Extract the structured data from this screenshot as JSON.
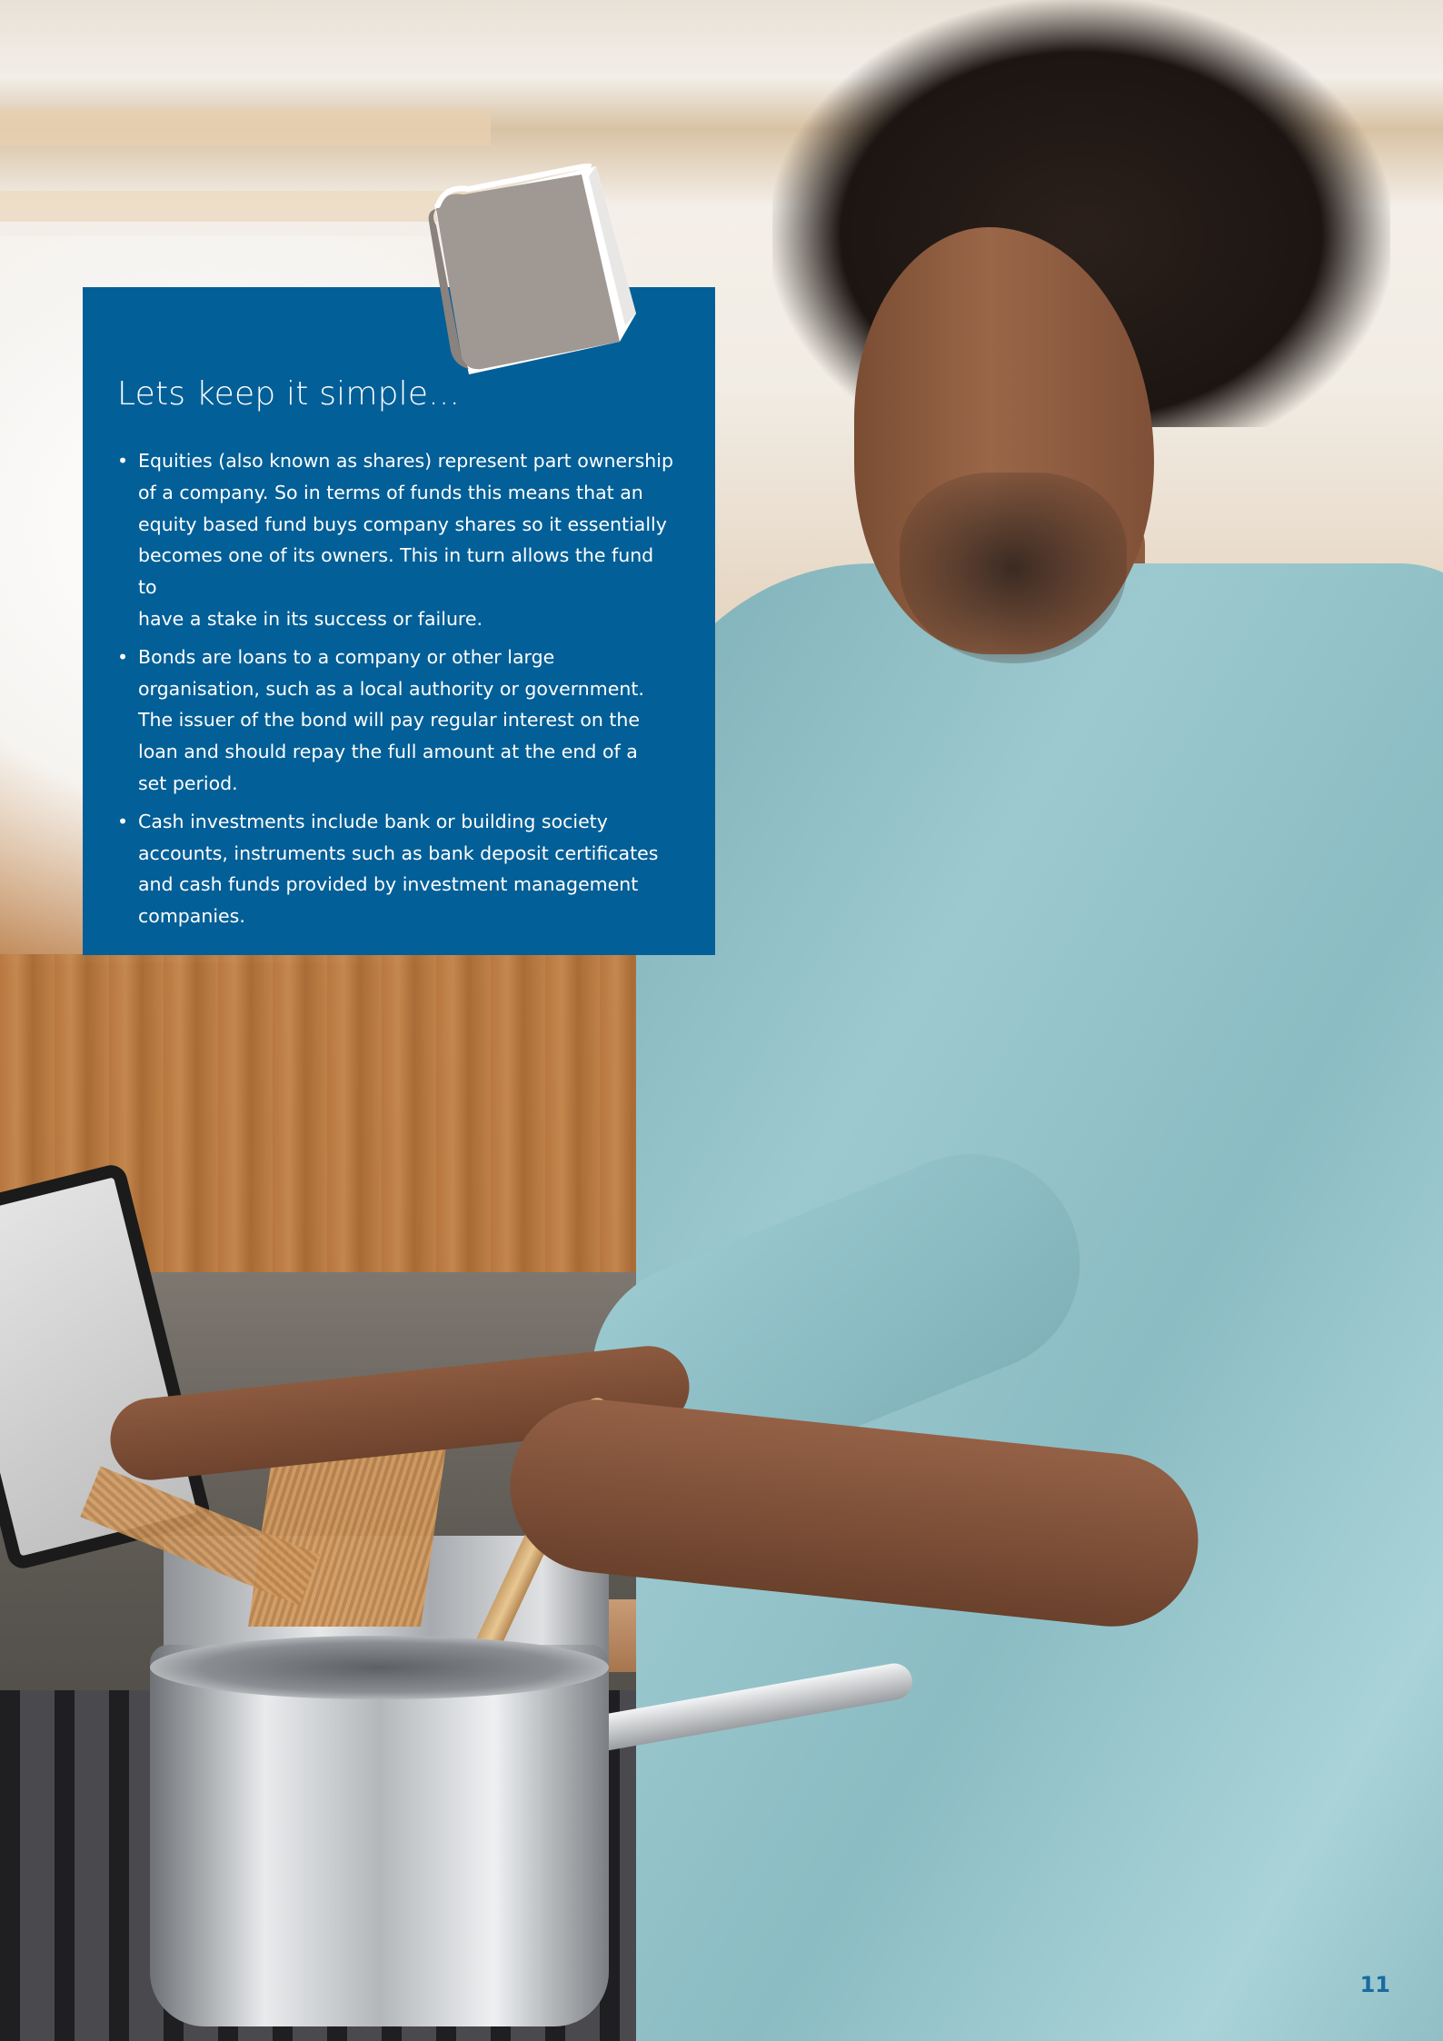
{
  "page": {
    "page_number": "11"
  },
  "info_box": {
    "title": "Lets keep it simple...",
    "bullet_glyph": "•",
    "bullets": [
      {
        "lines": [
          "Equities (also known as shares) represent part ownership",
          "of a company. So in terms of funds this means that an",
          "equity based fund buys company shares so it essentially",
          "becomes one of its owners. This in turn allows the fund to",
          "have a stake in its success or failure."
        ]
      },
      {
        "lines": [
          "Bonds are loans to a company or other large",
          "organisation, such as a local authority or government.",
          "The issuer of the bond will pay regular interest on the",
          "loan and should repay the full amount at the end of a",
          "set period."
        ]
      },
      {
        "lines": [
          "Cash investments include bank or building society",
          "accounts, instruments such as bank deposit certificates",
          "and cash funds provided by investment management",
          "companies."
        ]
      }
    ]
  },
  "icons": {
    "book": "book-icon"
  },
  "colors": {
    "box_background": "#035f97",
    "page_number": "#1a6aa2",
    "book_cover": "#a09893"
  }
}
